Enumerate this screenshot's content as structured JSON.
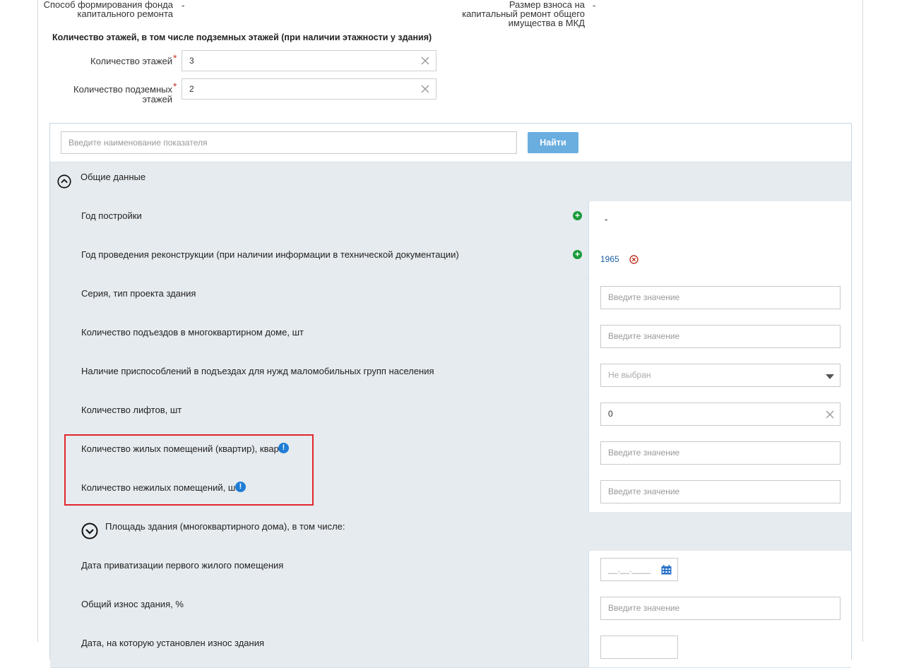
{
  "top": {
    "fund_label": "Способ формирования фонда капитального ремонта",
    "fund_value": "-",
    "fee_label": "Размер взноса на капитальный ремонт общего имущества в МКД",
    "fee_value": "-"
  },
  "floors": {
    "title": "Количество этажей, в том числе подземных этажей (при наличии этажности у здания)",
    "floors_label": "Количество этажей",
    "floors_value": "3",
    "underground_label": "Количество подземных этажей",
    "underground_value": "2",
    "required_mark": "*"
  },
  "search": {
    "placeholder": "Введите наименование показателя",
    "button_label": "Найти"
  },
  "sections": {
    "general": "Общие данные",
    "area": "Площадь здания (многоквартирного дома), в том числе:"
  },
  "rows": [
    {
      "label": "Год постройки",
      "value": "-"
    },
    {
      "label": "Год проведения реконструкции (при наличии информации в технической документации)",
      "value": "1965"
    },
    {
      "label": "Серия, тип проекта здания",
      "placeholder": "Введите значение"
    },
    {
      "label": "Количество подъездов в многоквартирном доме, шт",
      "placeholder": "Введите значение"
    },
    {
      "label": "Наличие приспособлений в подъездах для нужд маломобильных групп населения",
      "select_value": "Не выбран"
    },
    {
      "label": "Количество лифтов, шт",
      "value": "0"
    },
    {
      "label": "Количество жилых помещений (квартир), кварт",
      "placeholder": "Введите значение"
    },
    {
      "label": "Количество нежилых помещений, шт",
      "placeholder": "Введите значение"
    }
  ],
  "rows2": [
    {
      "label": "Дата приватизации первого жилого помещения",
      "placeholder": "__.__.____"
    },
    {
      "label": "Общий износ здания, %",
      "placeholder": "Введите значение"
    },
    {
      "label": "Дата, на которую установлен износ здания"
    }
  ],
  "colors": {
    "accent": "#6aaee0",
    "highlight": "#e0262c",
    "add": "#1a9a3a",
    "info": "#1f7dd6",
    "link": "#1a5fa8"
  }
}
